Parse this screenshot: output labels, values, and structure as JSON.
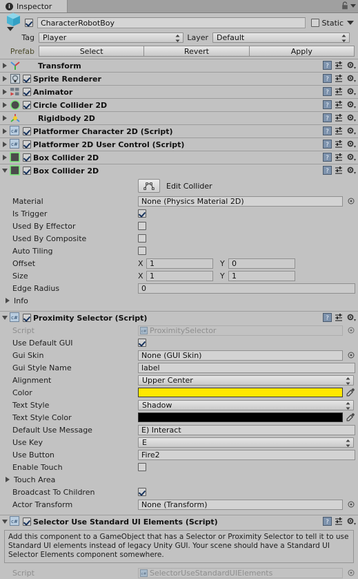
{
  "window": {
    "tab_label": "Inspector",
    "tab_icon": "info-circle-icon",
    "lock_icon": "lock-icon",
    "menu_icon": "chevron-down-icon"
  },
  "header": {
    "object_name": "CharacterRobotBoy",
    "object_enabled": true,
    "prefab_icon": "prefab-cube-icon",
    "static_label": "Static",
    "static_checked": false,
    "tag_label": "Tag",
    "tag_value": "Player",
    "layer_label": "Layer",
    "layer_value": "Default",
    "prefab_label": "Prefab",
    "prefab_buttons": [
      "Select",
      "Revert",
      "Apply"
    ]
  },
  "components": [
    {
      "name": "Transform",
      "icon": "transform-axis-icon",
      "expanded": false,
      "has_checkbox": false,
      "checked": false
    },
    {
      "name": "Sprite Renderer",
      "icon": "sprite-renderer-icon",
      "expanded": false,
      "has_checkbox": true,
      "checked": true
    },
    {
      "name": "Animator",
      "icon": "animator-icon",
      "expanded": false,
      "has_checkbox": true,
      "checked": true
    },
    {
      "name": "Circle Collider 2D",
      "icon": "circle-collider-2d-icon",
      "expanded": false,
      "has_checkbox": true,
      "checked": true
    },
    {
      "name": "Rigidbody 2D",
      "icon": "rigidbody-2d-icon",
      "expanded": false,
      "has_checkbox": false,
      "checked": false
    },
    {
      "name": "Platformer Character 2D (Script)",
      "icon": "csharp-script-icon",
      "expanded": false,
      "has_checkbox": true,
      "checked": true
    },
    {
      "name": "Platformer 2D User Control (Script)",
      "icon": "csharp-script-icon",
      "expanded": false,
      "has_checkbox": true,
      "checked": true
    },
    {
      "name": "Box Collider 2D",
      "icon": "box-collider-2d-icon",
      "expanded": false,
      "has_checkbox": true,
      "checked": true
    }
  ],
  "box_collider": {
    "name": "Box Collider 2D",
    "icon": "box-collider-2d-icon",
    "checked": true,
    "edit_collider_label": "Edit Collider",
    "edit_collider_icon": "edit-collider-icon",
    "material_label": "Material",
    "material_value": "None (Physics Material 2D)",
    "is_trigger_label": "Is Trigger",
    "is_trigger_checked": true,
    "used_by_effector_label": "Used By Effector",
    "used_by_effector_checked": false,
    "used_by_composite_label": "Used By Composite",
    "used_by_composite_checked": false,
    "auto_tiling_label": "Auto Tiling",
    "auto_tiling_checked": false,
    "offset_label": "Offset",
    "offset_x_axis": "X",
    "offset_x": "1",
    "offset_y_axis": "Y",
    "offset_y": "0",
    "size_label": "Size",
    "size_x_axis": "X",
    "size_x": "1",
    "size_y_axis": "Y",
    "size_y": "1",
    "edge_radius_label": "Edge Radius",
    "edge_radius_value": "0",
    "info_label": "Info"
  },
  "proximity_selector": {
    "name": "Proximity Selector (Script)",
    "icon": "csharp-script-icon",
    "checked": true,
    "script_label": "Script",
    "script_value": "ProximitySelector",
    "use_default_gui_label": "Use Default GUI",
    "use_default_gui_checked": true,
    "gui_skin_label": "Gui Skin",
    "gui_skin_value": "None (GUI Skin)",
    "gui_style_name_label": "Gui Style Name",
    "gui_style_name_value": "label",
    "alignment_label": "Alignment",
    "alignment_value": "Upper Center",
    "color_label": "Color",
    "color_value": "#FFE800",
    "text_style_label": "Text Style",
    "text_style_value": "Shadow",
    "text_style_color_label": "Text Style Color",
    "text_style_color_value": "#000000",
    "default_use_message_label": "Default Use Message",
    "default_use_message_value": "E) Interact",
    "use_key_label": "Use Key",
    "use_key_value": "E",
    "use_button_label": "Use Button",
    "use_button_value": "Fire2",
    "enable_touch_label": "Enable Touch",
    "enable_touch_checked": false,
    "touch_area_label": "Touch Area",
    "broadcast_to_children_label": "Broadcast To Children",
    "broadcast_to_children_checked": true,
    "actor_transform_label": "Actor Transform",
    "actor_transform_value": "None (Transform)"
  },
  "selector_use_standard_ui": {
    "name": "Selector Use Standard UI Elements (Script)",
    "icon": "csharp-script-icon",
    "checked": true,
    "help_text": "Add this component to a GameObject that has a Selector or Proximity Selector to tell it to use Standard UI elements instead of legacy Unity GUI. Your scene should have a Standard UI Selector Elements component somewhere.",
    "script_label": "Script",
    "script_value": "SelectorUseStandardUIElements"
  },
  "row_icons": {
    "help": "help-book-icon",
    "preset": "preset-sliders-icon",
    "settings": "gear-icon"
  }
}
